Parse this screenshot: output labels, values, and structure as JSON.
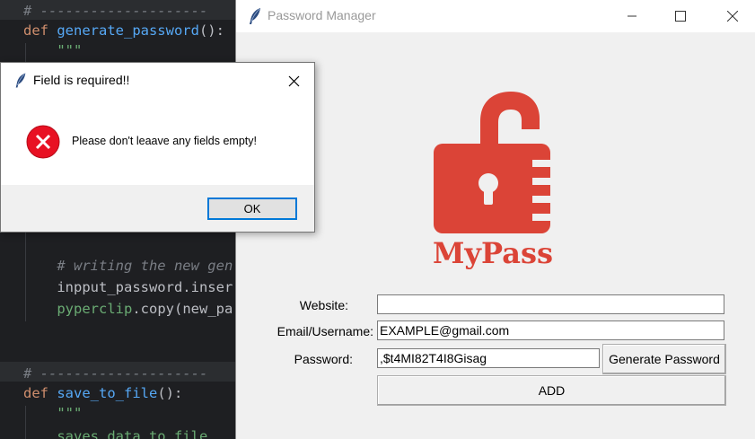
{
  "editor": {
    "lines": [
      {
        "segments": [
          {
            "c": "cm",
            "t": "# --------------------"
          }
        ]
      },
      {
        "segments": [
          {
            "c": "kw",
            "t": "def "
          },
          {
            "c": "fn",
            "t": "generate_password"
          },
          {
            "c": "tx",
            "t": "():"
          }
        ]
      },
      {
        "segments": [
          {
            "c": "str",
            "t": "    \"\"\""
          }
        ]
      },
      {
        "segments": [
          {
            "c": "cm",
            "t": "    # writing the new gen"
          }
        ]
      },
      {
        "segments": [
          {
            "c": "tx",
            "t": "    inpput_password.inser"
          }
        ]
      },
      {
        "segments": [
          {
            "c": "py",
            "t": "    pyperclip"
          },
          {
            "c": "tx",
            "t": ".copy("
          },
          {
            "c": "tx",
            "t": "new_pa"
          }
        ]
      },
      {
        "segments": [
          {
            "c": "cm",
            "t": "# --------------------"
          }
        ]
      },
      {
        "segments": [
          {
            "c": "kw",
            "t": "def "
          },
          {
            "c": "fn",
            "t": "save_to_file"
          },
          {
            "c": "tx",
            "t": "():"
          }
        ]
      },
      {
        "segments": [
          {
            "c": "str",
            "t": "    \"\"\""
          }
        ]
      },
      {
        "segments": [
          {
            "c": "str",
            "t": "    saves data to file"
          }
        ]
      }
    ]
  },
  "pm_window": {
    "title": "Password Manager",
    "logo_text": "MyPass",
    "logo_color": "#db4437",
    "labels": {
      "website": "Website:",
      "email": "Email/Username:",
      "password": "Password:"
    },
    "fields": {
      "website_value": "",
      "email_value": "EXAMPLE@gmail.com",
      "password_value": ",$t4MI82T4I8Gisag"
    },
    "buttons": {
      "generate": "Generate Password",
      "add": "ADD"
    }
  },
  "dialog": {
    "title": "Field is required!!",
    "message": "Please don't leaave any fields empty!",
    "ok_label": "OK",
    "icon": "error-icon",
    "accent_color": "#0078d7",
    "error_color": "#e81123"
  }
}
